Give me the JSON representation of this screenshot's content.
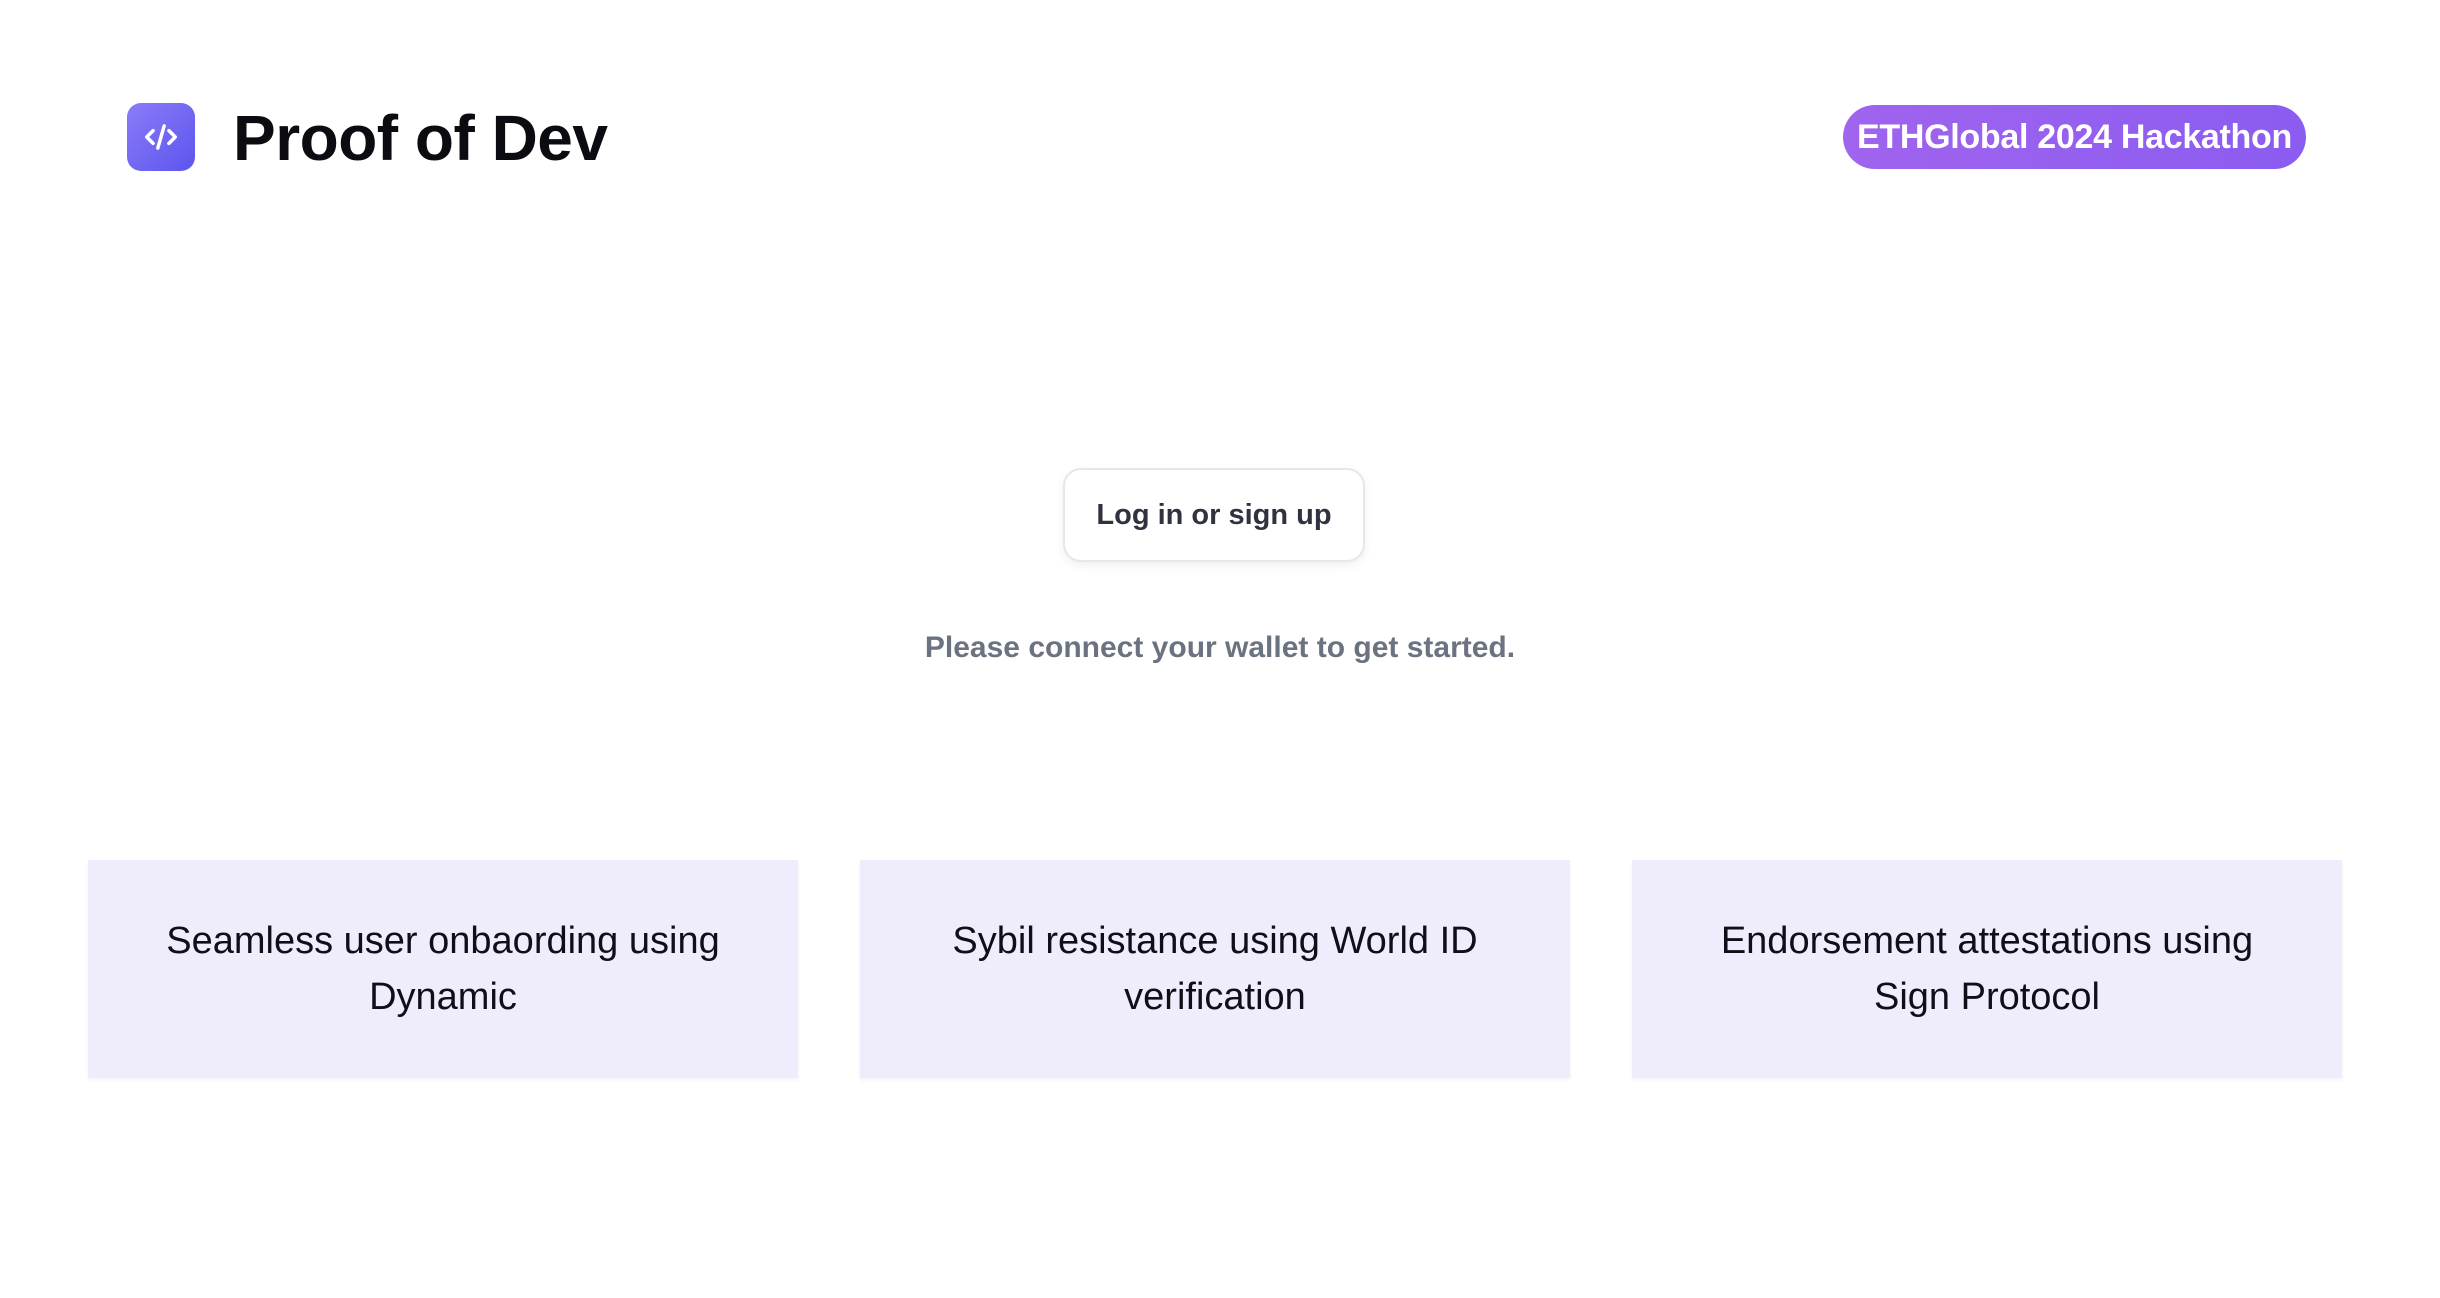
{
  "header": {
    "logo_icon": "code-brackets-icon",
    "title": "Proof of Dev",
    "badge": "ETHGlobal 2024 Hackathon"
  },
  "main": {
    "login_button": "Log in or sign up",
    "hint": "Please connect your wallet to get started."
  },
  "features": [
    {
      "text": "Seamless user onbaording using Dynamic"
    },
    {
      "text": "Sybil resistance using World ID verification"
    },
    {
      "text": "Endorsement attestations using Sign Protocol"
    }
  ],
  "colors": {
    "accent": "#6d5cf2",
    "badge": "#9360ef",
    "card_bg": "#efedfc",
    "hint_text": "#6b7280"
  }
}
